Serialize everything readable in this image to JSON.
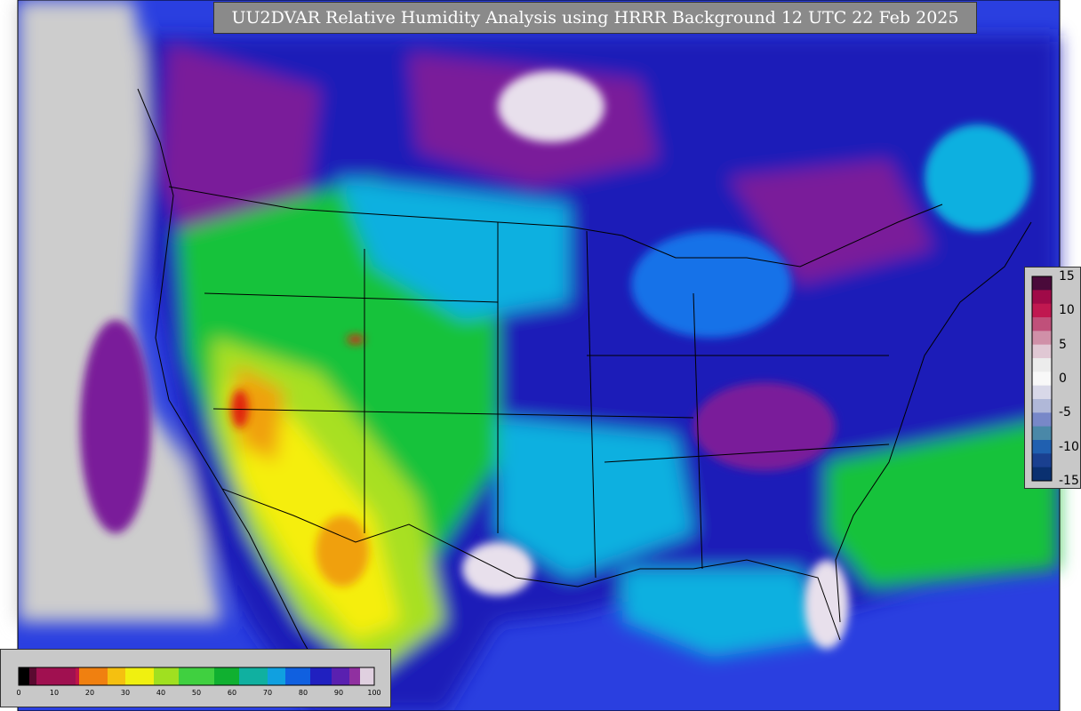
{
  "title": "UU2DVAR Relative Humidity Analysis using HRRR Background 12 UTC 22 Feb 2025",
  "map_colors": {
    "ocean_gray": "#cdcdcd",
    "deep_blue": "#1d1db8",
    "blue": "#2a3fe0",
    "mid_blue": "#1672e8",
    "cyan": "#10b0e0",
    "green": "#18c23a",
    "lime": "#a8e020",
    "yellow": "#f5ee10",
    "orange": "#f0a010",
    "red": "#e02010",
    "purple": "#7a1a9a",
    "pale": "#e8e0ec",
    "border": "#000000"
  },
  "rh_colorbar": {
    "ticks": [
      "0",
      "10",
      "20",
      "30",
      "40",
      "50",
      "60",
      "70",
      "80",
      "90",
      "100"
    ],
    "stops": [
      {
        "value": 0,
        "color": "#000000"
      },
      {
        "value": 3,
        "color": "#5a0a30"
      },
      {
        "value": 5,
        "color": "#a01050"
      },
      {
        "value": 16,
        "color": "#c01448"
      },
      {
        "value": 17,
        "color": "#f08010"
      },
      {
        "value": 25,
        "color": "#f5c010"
      },
      {
        "value": 30,
        "color": "#f0f010"
      },
      {
        "value": 38,
        "color": "#a0e020"
      },
      {
        "value": 45,
        "color": "#40d040"
      },
      {
        "value": 55,
        "color": "#10b030"
      },
      {
        "value": 62,
        "color": "#10b0a0"
      },
      {
        "value": 70,
        "color": "#10a0e0"
      },
      {
        "value": 75,
        "color": "#1060e0"
      },
      {
        "value": 82,
        "color": "#2020c0"
      },
      {
        "value": 88,
        "color": "#5a20b0"
      },
      {
        "value": 93,
        "color": "#9030a0"
      },
      {
        "value": 96,
        "color": "#e0d0e0"
      },
      {
        "value": 100,
        "color": "#f5f5f5"
      }
    ]
  },
  "diff_colorbar": {
    "ticks": [
      "15",
      "10",
      "5",
      "0",
      "-5",
      "-10",
      "-15"
    ],
    "segments": [
      "#4a0a3a",
      "#a00a48",
      "#c01850",
      "#c0507a",
      "#d090a8",
      "#e0c8d4",
      "#ececec",
      "#f8f8f8",
      "#d8d8e8",
      "#b0b8d8",
      "#7888c8",
      "#4a88a8",
      "#2060b0",
      "#1a4090",
      "#0a3070"
    ]
  }
}
